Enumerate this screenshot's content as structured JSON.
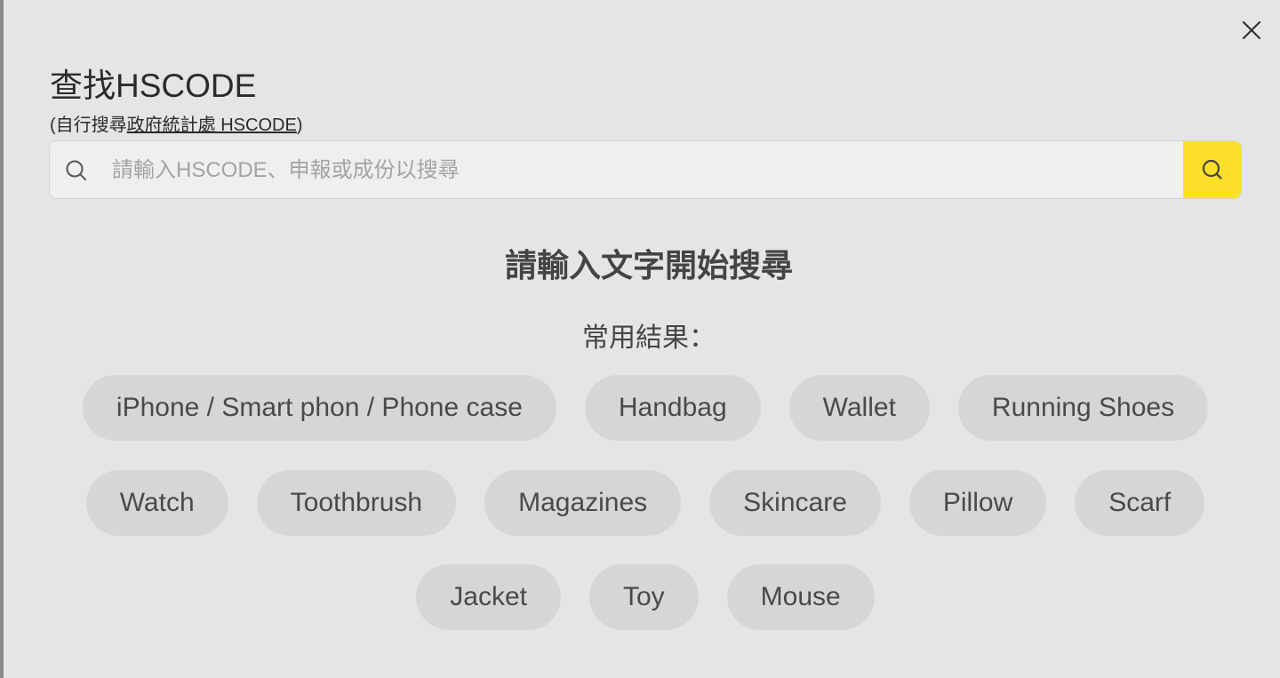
{
  "modal": {
    "title": "查找HSCODE",
    "subtitle_prefix": "(自行搜尋",
    "subtitle_link": "政府統計處 HSCODE",
    "subtitle_suffix": ")",
    "close_icon": "close-icon"
  },
  "search": {
    "placeholder": "請輸入HSCODE、申報或成份以搜尋",
    "value": "",
    "icon": "search-icon",
    "button_icon": "search-icon",
    "button_color": "#fde02a"
  },
  "empty_state": {
    "prompt": "請輸入文字開始搜尋",
    "common_label": "常用結果："
  },
  "common_results": {
    "rows": [
      [
        "iPhone / Smart phon / Phone case",
        "Handbag",
        "Wallet",
        "Running Shoes"
      ],
      [
        "Watch",
        "Toothbrush",
        "Magazines",
        "Skincare",
        "Pillow",
        "Scarf"
      ],
      [
        "Jacket",
        "Toy",
        "Mouse"
      ]
    ]
  }
}
